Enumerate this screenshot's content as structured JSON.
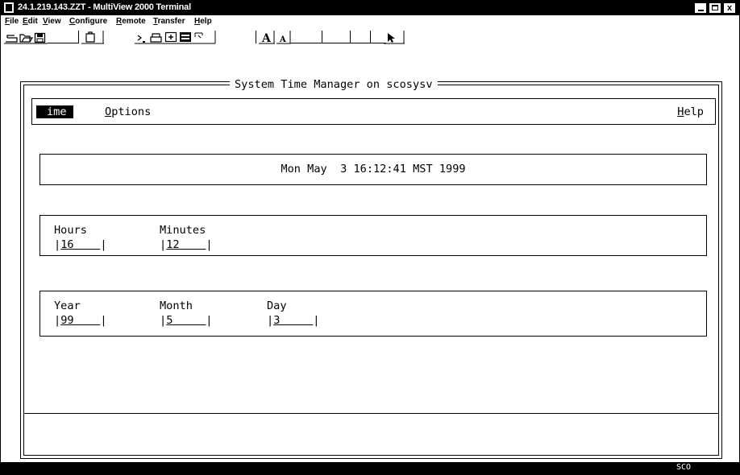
{
  "window": {
    "title": "24.1.219.143.ZZT - MultiView 2000 Terminal",
    "buttons": {
      "minimize": "_",
      "maximize": "□",
      "close": "x"
    }
  },
  "menubar": {
    "items": [
      {
        "label": "File",
        "accel": "F",
        "rest": "ile"
      },
      {
        "label": "Edit",
        "accel": "E",
        "rest": "dit"
      },
      {
        "label": "View",
        "accel": "V",
        "rest": "iew"
      },
      {
        "label": "Configure",
        "accel": "C",
        "rest": "onfigure"
      },
      {
        "label": "Remote",
        "accel": "R",
        "rest": "emote"
      },
      {
        "label": "Transfer",
        "accel": "T",
        "rest": "ransfer"
      },
      {
        "label": "Help",
        "accel": "H",
        "rest": "elp"
      }
    ]
  },
  "toolbar": {
    "icons": [
      "print-icon",
      "open-icon",
      "save-icon",
      "blank",
      "clipboard-icon",
      "prompt-icon",
      "printer-icon",
      "add-icon",
      "keyboard-icon",
      "script-icon",
      "blank",
      "font-large-icon",
      "font-small-icon",
      "blank",
      "blank",
      "blank",
      "pointer-icon"
    ],
    "font_large": "A",
    "font_small": "A"
  },
  "terminal": {
    "frame_title": "System Time Manager on scosysv",
    "menu": {
      "time": "ime",
      "options_accel": "O",
      "options_rest": "ptions",
      "help_accel": "H",
      "help_rest": "elp"
    },
    "date_display": "Mon May  3 16:12:41 MST 1999",
    "time_fields": {
      "hours_label": "Hours",
      "hours_value": "16",
      "minutes_label": "Minutes",
      "minutes_value": "12"
    },
    "date_fields": {
      "year_label": "Year",
      "year_value": "99",
      "month_label": "Month",
      "month_value": "5",
      "day_label": "Day",
      "day_value": "3"
    }
  },
  "statusbar": {
    "text": "SCO"
  }
}
